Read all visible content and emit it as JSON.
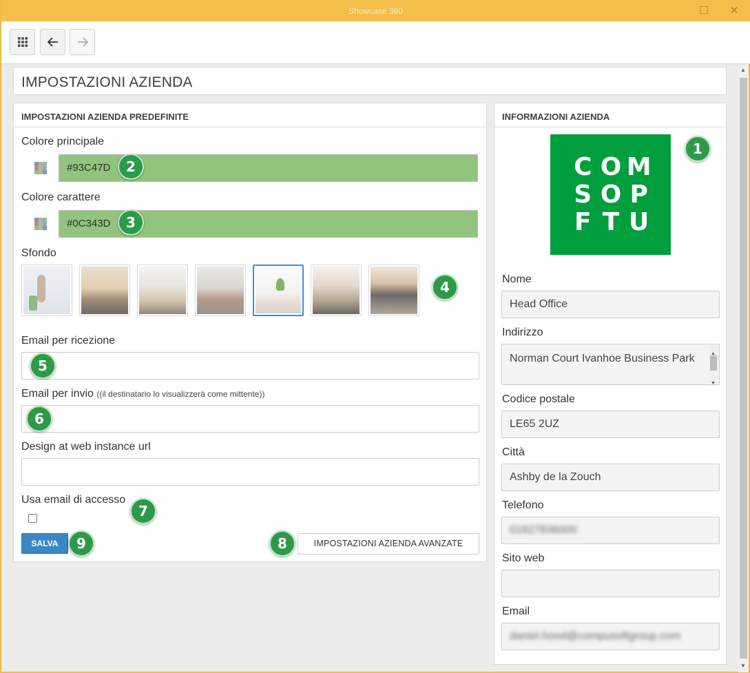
{
  "window": {
    "title": "Showcase 360"
  },
  "page": {
    "title": "IMPOSTAZIONI AZIENDA"
  },
  "left_panel": {
    "title": "IMPOSTAZIONI AZIENDA PREDEFINITE",
    "primary_color": {
      "label": "Colore principale",
      "value": "#93C47D"
    },
    "font_color": {
      "label": "Colore carattere",
      "value": "#0C343D"
    },
    "background": {
      "label": "Sfondo",
      "options": [
        "sfondo-1",
        "sfondo-2",
        "sfondo-3",
        "sfondo-4",
        "sfondo-5",
        "sfondo-6",
        "sfondo-7"
      ],
      "selected_index": 4
    },
    "email_receive": {
      "label": "Email per ricezione",
      "value": ""
    },
    "email_send": {
      "label": "Email per invio",
      "note": "((il destinatario lo visualizzerà come mittente))",
      "value": ""
    },
    "design_url": {
      "label": "Design at web instance url",
      "value": ""
    },
    "use_login_email": {
      "label": "Usa email di accesso",
      "checked": false
    },
    "save_button": "SALVA",
    "advanced_button": "IMPOSTAZIONI AZIENDA AVANZATE"
  },
  "right_panel": {
    "title": "INFORMAZIONI AZIENDA",
    "logo_letters": [
      "C",
      "O",
      "M",
      "S",
      "O",
      "P",
      "F",
      "T",
      "U"
    ],
    "name": {
      "label": "Nome",
      "value": "Head Office"
    },
    "address": {
      "label": "Indirizzo",
      "value": "Norman Court Ivanhoe Business Park"
    },
    "postcode": {
      "label": "Codice postale",
      "value": "LE65 2UZ"
    },
    "city": {
      "label": "Città",
      "value": "Ashby de la Zouch"
    },
    "phone": {
      "label": "Telefono",
      "value": "01827836000"
    },
    "website": {
      "label": "Sito web",
      "value": ""
    },
    "email": {
      "label": "Email",
      "value": "daniel.hood@compusoftgroup.com"
    }
  },
  "badges": [
    "1",
    "2",
    "3",
    "4",
    "5",
    "6",
    "7",
    "8",
    "9"
  ],
  "colors": {
    "accent": "#f5be4a",
    "primary": "#93c47d",
    "badge": "#2e9a49",
    "save": "#3c86c7"
  }
}
